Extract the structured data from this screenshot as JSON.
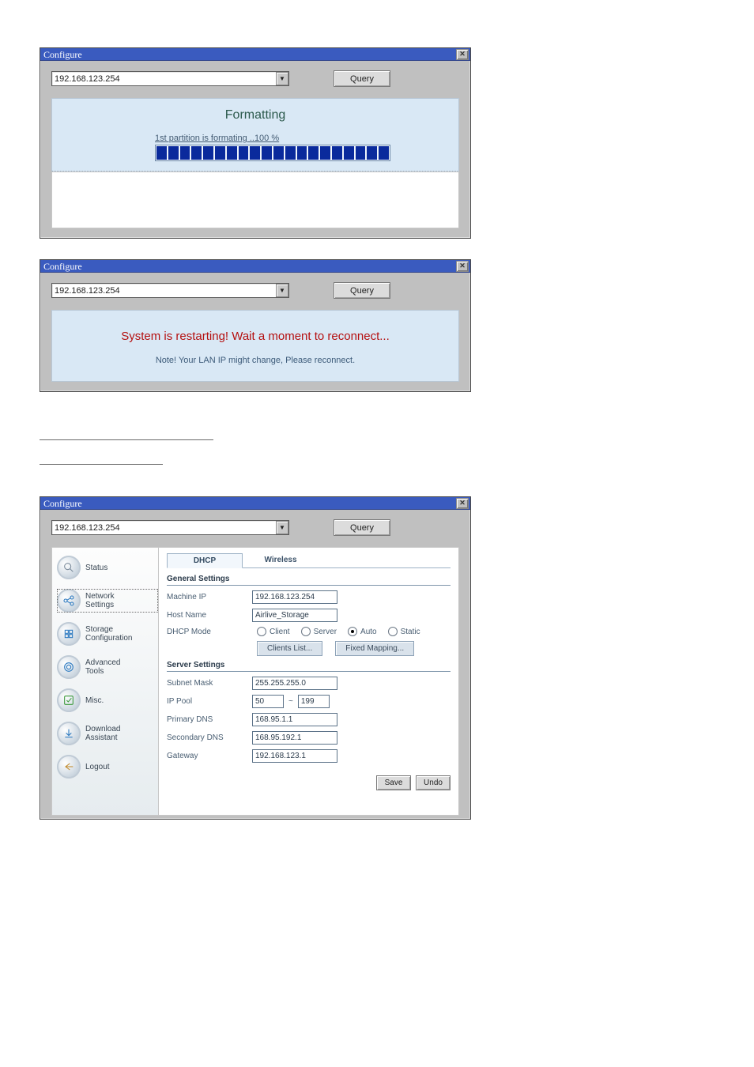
{
  "dialog1": {
    "title": "Configure",
    "ip": "192.168.123.254",
    "query": "Query",
    "panel_title": "Formatting",
    "progress_text": "1st partition is formating ..100 %",
    "progress_segments": 20
  },
  "dialog2": {
    "title": "Configure",
    "ip": "192.168.123.254",
    "query": "Query",
    "restart_title": "System is restarting! Wait a moment to reconnect...",
    "restart_note": "Note! Your LAN IP might change, Please reconnect."
  },
  "dialog3": {
    "title": "Configure",
    "ip": "192.168.123.254",
    "query": "Query",
    "sidebar": [
      {
        "label": "Status",
        "icon": "magnifier"
      },
      {
        "label": "Network\nSettings",
        "icon": "network"
      },
      {
        "label": "Storage\nConfiguration",
        "icon": "grid"
      },
      {
        "label": "Advanced\nTools",
        "icon": "gear"
      },
      {
        "label": "Misc.",
        "icon": "check"
      },
      {
        "label": "Download\nAssistant",
        "icon": "download"
      },
      {
        "label": "Logout",
        "icon": "back"
      }
    ],
    "tabs": {
      "active": "DHCP",
      "other": "Wireless"
    },
    "general": {
      "title": "General Settings",
      "machine_ip_label": "Machine IP",
      "machine_ip": "192.168.123.254",
      "host_name_label": "Host Name",
      "host_name": "Airlive_Storage",
      "dhcp_mode_label": "DHCP Mode",
      "modes": {
        "client": "Client",
        "server": "Server",
        "auto": "Auto",
        "static": "Static",
        "selected": "auto"
      },
      "clients_list_btn": "Clients List...",
      "fixed_mapping_btn": "Fixed Mapping..."
    },
    "server": {
      "title": "Server Settings",
      "subnet_label": "Subnet Mask",
      "subnet": "255.255.255.0",
      "ip_pool_label": "IP Pool",
      "pool_from": "50",
      "pool_to": "199",
      "pool_sep": "~",
      "primary_dns_label": "Primary DNS",
      "primary_dns": "168.95.1.1",
      "secondary_dns_label": "Secondary DNS",
      "secondary_dns": "168.95.192.1",
      "gateway_label": "Gateway",
      "gateway": "192.168.123.1"
    },
    "footer": {
      "save": "Save",
      "undo": "Undo"
    }
  }
}
